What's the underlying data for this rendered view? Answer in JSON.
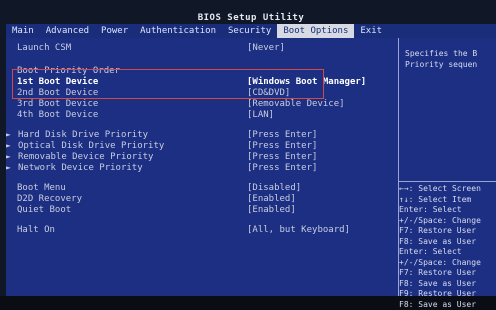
{
  "title": "BIOS Setup Utility",
  "tabs": [
    {
      "label": "Main"
    },
    {
      "label": "Advanced"
    },
    {
      "label": "Power"
    },
    {
      "label": "Authentication"
    },
    {
      "label": "Security"
    },
    {
      "label": "Boot Options"
    },
    {
      "label": "Exit"
    }
  ],
  "launch_csm": {
    "label": "Launch CSM",
    "value": "[Never]"
  },
  "boot_priority_heading": "Boot Priority Order",
  "boot_devices": [
    {
      "label": "1st Boot Device",
      "value": "[Windows Boot Manager]"
    },
    {
      "label": "2nd Boot Device",
      "value": "[CD&DVD]"
    },
    {
      "label": "3rd Boot Device",
      "value": "[Removable Device]"
    },
    {
      "label": "4th Boot Device",
      "value": "[LAN]"
    }
  ],
  "submenus": [
    {
      "label": "Hard Disk Drive Priority",
      "value": "[Press Enter]"
    },
    {
      "label": "Optical Disk Drive Priority",
      "value": "[Press Enter]"
    },
    {
      "label": "Removable Device Priority",
      "value": "[Press Enter]"
    },
    {
      "label": "Network Device Priority",
      "value": "[Press Enter]"
    }
  ],
  "options": [
    {
      "label": "Boot Menu",
      "value": "[Disabled]"
    },
    {
      "label": "D2D Recovery",
      "value": "[Enabled]"
    },
    {
      "label": "Quiet Boot",
      "value": "[Enabled]"
    }
  ],
  "halt_on": {
    "label": "Halt On",
    "value": "[All, but Keyboard]"
  },
  "help": {
    "description": "Specifies the B\nPriority sequen",
    "keys": [
      "←→: Select Screen",
      "↑↓: Select Item",
      "Enter: Select",
      "+/-/Space: Change",
      "F7: Restore User",
      "F8: Save as User",
      "Enter: Select",
      "+/-/Space: Change",
      "F7: Restore User",
      "F8: Save as User",
      "F9: Restore User",
      "F8: Save as User"
    ]
  },
  "colors": {
    "accent": "#1c2f82",
    "highlight_box": "#d44848"
  }
}
